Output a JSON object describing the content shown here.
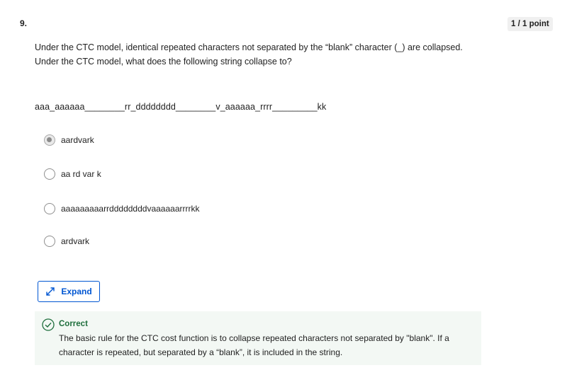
{
  "question": {
    "number": "9.",
    "points": "1 / 1 point",
    "prompt_line1": "Under the CTC model, identical repeated characters not separated by the “blank” character (_) are collapsed.",
    "prompt_line2": "Under the CTC model, what does the following string collapse to?",
    "sequence": "aaa_aaaaaa________rr_dddddddd________v_aaaaaa_rrrr_________kk"
  },
  "options": [
    {
      "label": "aardvark",
      "selected": true
    },
    {
      "label": "aa rd var k",
      "selected": false
    },
    {
      "label": "aaaaaaaaarrddddddddvaaaaaarrrrkk",
      "selected": false
    },
    {
      "label": "ardvark",
      "selected": false
    }
  ],
  "expand_button": {
    "label": "Expand",
    "icon": "expand-arrows-icon"
  },
  "feedback": {
    "status": "Correct",
    "icon": "check-circle-icon",
    "text": "The basic rule for the CTC cost function is to collapse repeated characters not separated by \"blank\". If a character is repeated, but separated by a “blank”, it is included in the string."
  },
  "colors": {
    "accent": "#0056d2",
    "success": "#1e6e3c",
    "feedback_bg": "#f3f8f4"
  }
}
